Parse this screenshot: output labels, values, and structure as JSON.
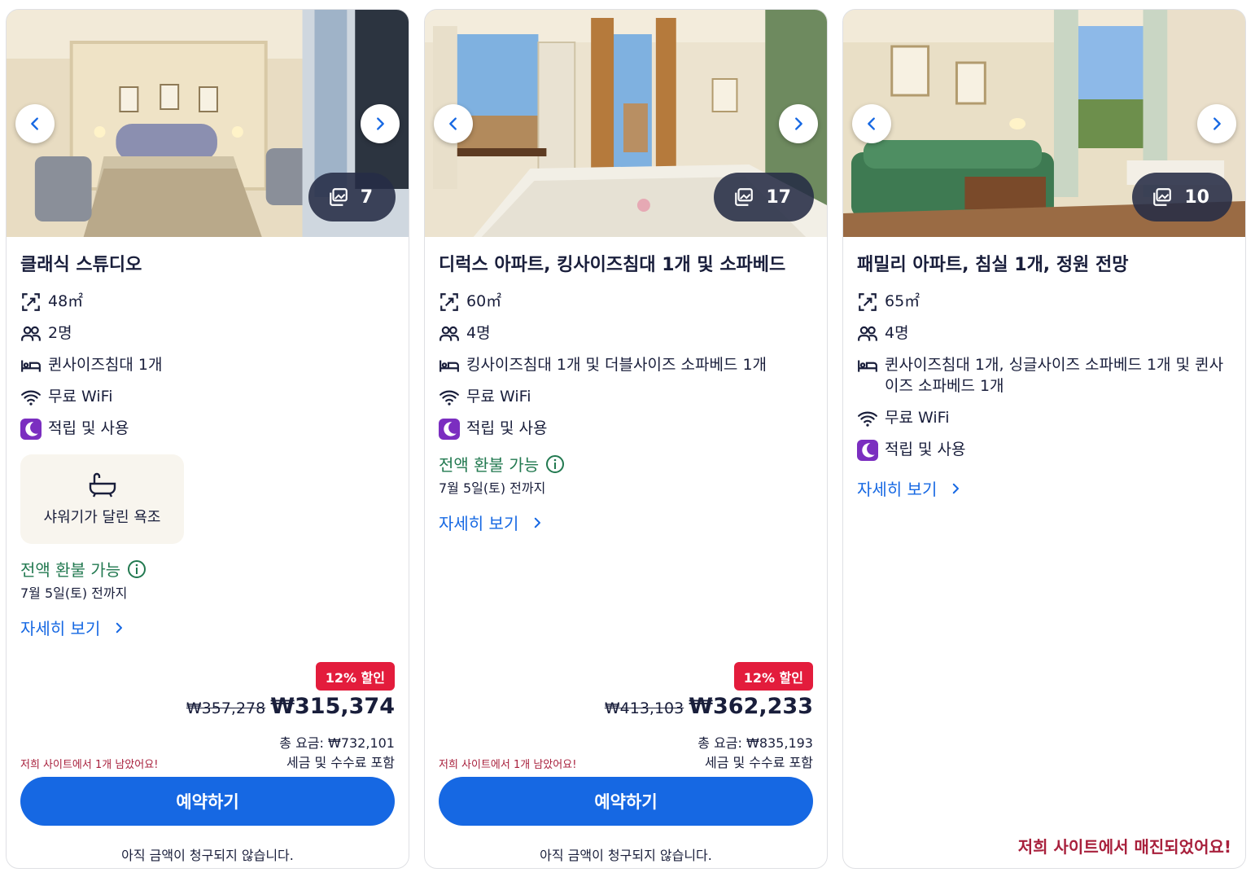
{
  "cards": [
    {
      "photo_count": "7",
      "title": "클래식 스튜디오",
      "area": "48㎡",
      "guests": "2명",
      "beds": "퀸사이즈침대 1개",
      "wifi": "무료 WiFi",
      "rewards": "적립 및 사용",
      "amenity": "샤워기가 달린 욕조",
      "refund": "전액 환불 가능",
      "refund_date": "7월 5일(토) 전까지",
      "details": "자세히 보기",
      "discount": "12% 할인",
      "old_price": "₩357,278",
      "price": "₩315,374",
      "total": "총 요금: ₩732,101",
      "taxes": "세금 및 수수료 포함",
      "scarcity": "저희 사이트에서 1개 남았어요!",
      "reserve": "예약하기",
      "no_charge": "아직 금액이 청구되지 않습니다."
    },
    {
      "photo_count": "17",
      "title": "디럭스 아파트, 킹사이즈침대 1개 및 소파베드",
      "area": "60㎡",
      "guests": "4명",
      "beds": "킹사이즈침대 1개 및 더블사이즈 소파베드 1개",
      "wifi": "무료 WiFi",
      "rewards": "적립 및 사용",
      "refund": "전액 환불 가능",
      "refund_date": "7월 5일(토) 전까지",
      "details": "자세히 보기",
      "discount": "12% 할인",
      "old_price": "₩413,103",
      "price": "₩362,233",
      "total": "총 요금: ₩835,193",
      "taxes": "세금 및 수수료 포함",
      "scarcity": "저희 사이트에서 1개 남았어요!",
      "reserve": "예약하기",
      "no_charge": "아직 금액이 청구되지 않습니다."
    },
    {
      "photo_count": "10",
      "title": "패밀리 아파트, 침실 1개, 정원 전망",
      "area": "65㎡",
      "guests": "4명",
      "beds": "퀸사이즈침대 1개, 싱글사이즈 소파베드 1개 및 퀸사이즈 소파베드 1개",
      "wifi": "무료 WiFi",
      "rewards": "적립 및 사용",
      "details": "자세히 보기",
      "soldout": "저희 사이트에서 매진되었어요!"
    }
  ],
  "colors": {
    "primary": "#1668e3",
    "refund_green": "#227950",
    "discount_red": "#e31c3c",
    "scarcity_red": "#a8203c",
    "rewards_purple": "#7b2ec0",
    "text": "#191e3b"
  }
}
